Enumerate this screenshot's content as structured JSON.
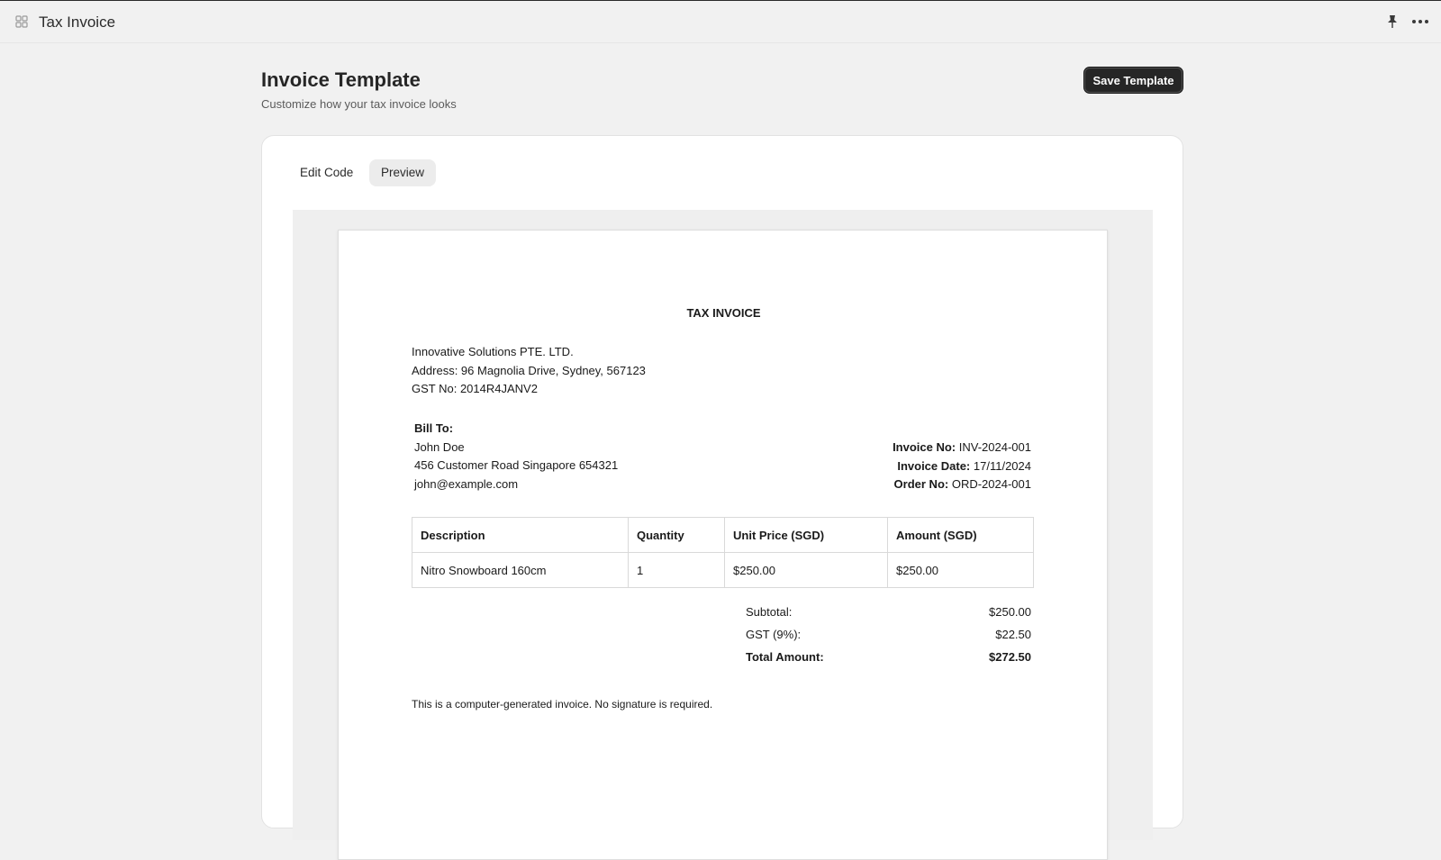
{
  "window": {
    "title": "Tax Invoice"
  },
  "header": {
    "title": "Invoice Template",
    "subtitle": "Customize how your tax invoice looks",
    "save_label": "Save Template"
  },
  "tabs": [
    {
      "label": "Edit Code",
      "active": false
    },
    {
      "label": "Preview",
      "active": true
    }
  ],
  "invoice": {
    "heading": "TAX INVOICE",
    "company": {
      "name": "Innovative Solutions PTE. LTD.",
      "address": "Address: 96 Magnolia Drive, Sydney, 567123",
      "gst": "GST No: 2014R4JANV2"
    },
    "bill_to": {
      "label": "Bill To:",
      "name": "John Doe",
      "address": "456 Customer Road Singapore 654321",
      "email": "john@example.com"
    },
    "meta": {
      "invoice_no_label": "Invoice No:",
      "invoice_no": "INV-2024-001",
      "invoice_date_label": "Invoice Date:",
      "invoice_date": "17/11/2024",
      "order_no_label": "Order No:",
      "order_no": "ORD-2024-001"
    },
    "table": {
      "headers": [
        "Description",
        "Quantity",
        "Unit Price (SGD)",
        "Amount (SGD)"
      ],
      "rows": [
        [
          "Nitro Snowboard 160cm",
          "1",
          "$250.00",
          "$250.00"
        ]
      ]
    },
    "totals": {
      "subtotal_label": "Subtotal:",
      "subtotal": "$250.00",
      "gst_label": "GST (9%):",
      "gst": "$22.50",
      "total_label": "Total Amount:",
      "total": "$272.50"
    },
    "footnote": "This is a computer-generated invoice. No signature is required."
  },
  "icons": {
    "app": "grid-icon",
    "pin": "pin-icon",
    "more": "more-horizontal-icon"
  },
  "colors": {
    "page_bg": "#f1f1f1",
    "button_bg": "#262626",
    "card_bg": "#ffffff"
  }
}
